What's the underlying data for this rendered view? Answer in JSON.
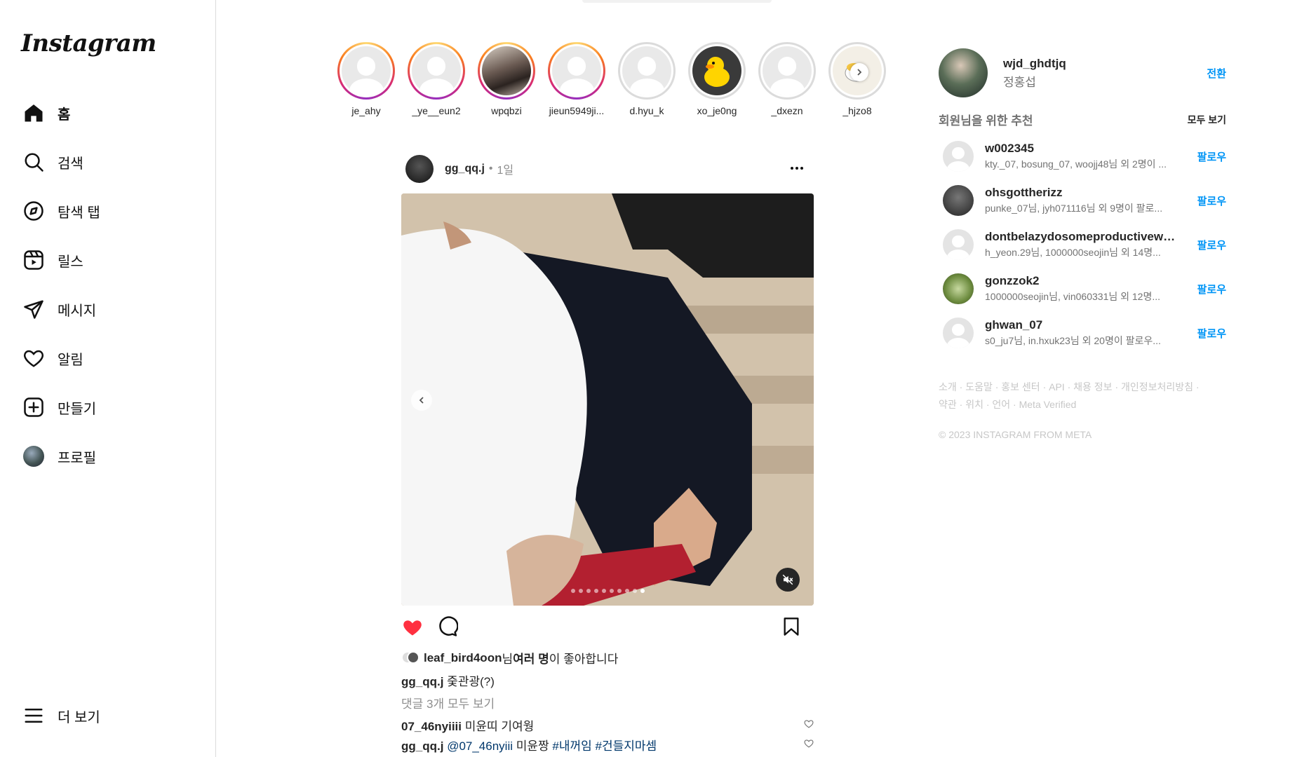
{
  "logo": "Instagram",
  "nav": {
    "home": "홈",
    "search": "검색",
    "explore": "탐색 탭",
    "reels": "릴스",
    "messages": "메시지",
    "notifications": "알림",
    "create": "만들기",
    "profile": "프로필",
    "more": "더 보기"
  },
  "stories": [
    {
      "username": "je_ahy",
      "seen": false,
      "avatar": "default"
    },
    {
      "username": "_ye__eun2",
      "seen": false,
      "avatar": "default"
    },
    {
      "username": "wpqbzi",
      "seen": false,
      "avatar": "photo"
    },
    {
      "username": "jieun5949ji...",
      "seen": false,
      "avatar": "default"
    },
    {
      "username": "d.hyu_k",
      "seen": true,
      "avatar": "default"
    },
    {
      "username": "xo_je0ng",
      "seen": true,
      "avatar": "duck"
    },
    {
      "username": "_dxezn",
      "seen": true,
      "avatar": "default"
    },
    {
      "username": "_hjzo8",
      "seen": true,
      "avatar": "cartoon"
    }
  ],
  "post": {
    "username": "gg_qq.j",
    "time": "1일",
    "carousel_count": 10,
    "carousel_active_index": 9,
    "liked": true,
    "likes": {
      "user": "leaf_bird4oon",
      "suffix_nim": "님 ",
      "others": "여러 명",
      "suffix": "이 좋아합니다"
    },
    "caption": {
      "user": "gg_qq.j",
      "text": "줒관광(?)"
    },
    "view_comments": "댓글 3개 모두 보기",
    "comments": [
      {
        "user": "07_46nyiiii",
        "mention": "",
        "text": "미윤띠 기여웡"
      },
      {
        "user": "gg_qq.j",
        "mention": "@07_46nyiii",
        "text": "미윤짱",
        "tags": "#내꺼임 #건들지마셈"
      }
    ]
  },
  "me": {
    "username": "wjd_ghdtjq",
    "name": "정홍섭",
    "switch": "전환"
  },
  "suggestions": {
    "title": "회원님을 위한 추천",
    "see_all": "모두 보기",
    "follow_label": "팔로우",
    "items": [
      {
        "username": "w002345",
        "sub": "kty._07, bosung_07, woojj48님 외 2명이 ...",
        "avatar": "default"
      },
      {
        "username": "ohsgottherizz",
        "sub": "punke_07님, jyh071116님 외 9명이 팔로...",
        "avatar": "dark"
      },
      {
        "username": "dontbelazydosomeproductivework",
        "sub": "h_yeon.29님, 1000000seojin님 외 14명...",
        "avatar": "default"
      },
      {
        "username": "gonzzok2",
        "sub": "1000000seojin님, vin060331님 외 12명...",
        "avatar": "green"
      },
      {
        "username": "ghwan_07",
        "sub": "s0_ju7님, in.hxuk23님 외 20명이 팔로우...",
        "avatar": "default"
      }
    ]
  },
  "footer": {
    "links": "소개 · 도움말 · 홍보 센터 · API · 채용 정보 · 개인정보처리방침 · 약관 · 위치 · 언어 · Meta Verified",
    "copyright": "© 2023 INSTAGRAM FROM META"
  },
  "colors": {
    "accent": "#0095f6",
    "like": "#ff3040",
    "text": "#262626",
    "muted": "#737373",
    "border": "#dbdbdb"
  }
}
